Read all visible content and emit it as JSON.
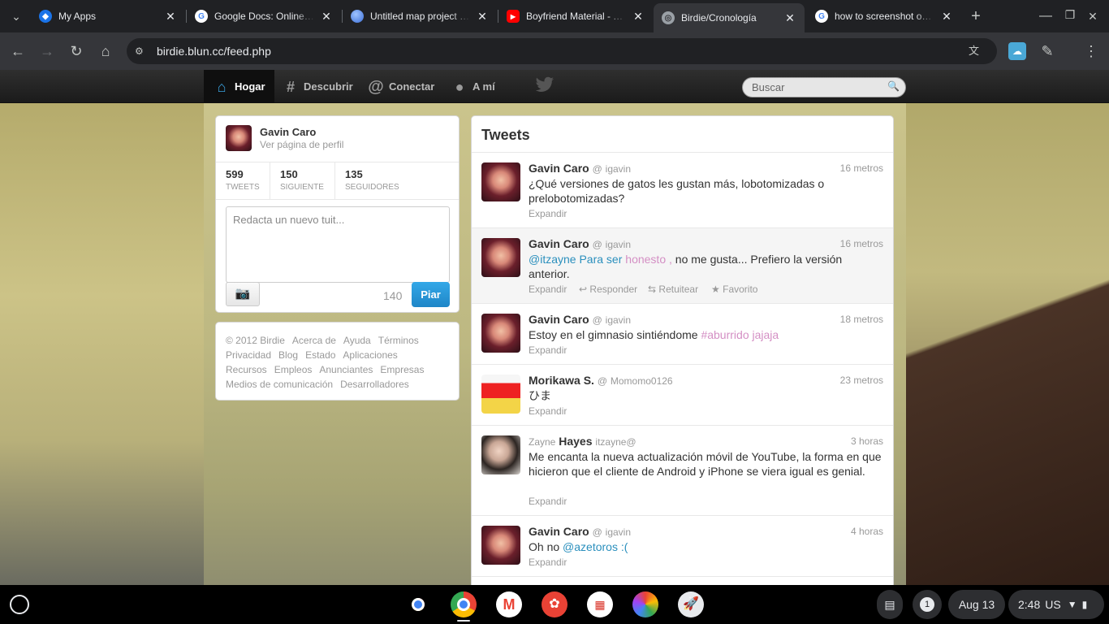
{
  "browser": {
    "tabs": [
      {
        "title": "My Apps",
        "favicon": "cloud-apps-icon",
        "color": "#1a73e8"
      },
      {
        "title": "Google Docs: Online Docu",
        "favicon": "google-g-icon",
        "color": "#4285f4"
      },
      {
        "title": "Untitled map project - Go",
        "favicon": "earth-icon",
        "color": "#4f7fe0"
      },
      {
        "title": "Boyfriend Material - YouTu",
        "favicon": "youtube-icon",
        "color": "#ff0000"
      },
      {
        "title": "Birdie/Cronología",
        "favicon": "globe-icon",
        "color": "#9aa0a6"
      },
      {
        "title": "how to screenshot on chro",
        "favicon": "google-g-icon",
        "color": "#4285f4"
      }
    ],
    "url": "birdie.blun.cc/feed.php"
  },
  "site": {
    "nav": [
      {
        "label": "Hogar",
        "icon": "home-icon"
      },
      {
        "label": "Descubrir",
        "icon": "hashtag-icon"
      },
      {
        "label": "Conectar",
        "icon": "at-icon"
      },
      {
        "label": "A mí",
        "icon": "user-icon"
      }
    ],
    "search_placeholder": "Buscar",
    "profile": {
      "name": "Gavin Caro",
      "link": "Ver página de perfil",
      "stats": [
        {
          "value": "599",
          "label": "TWEETS"
        },
        {
          "value": "150",
          "label": "SIGUIENTE"
        },
        {
          "value": "135",
          "label": "SEGUIDORES"
        }
      ],
      "compose_placeholder": "Redacta un nuevo tuit...",
      "char_count": "140",
      "post_button": "Piar"
    },
    "footer_links": [
      "© 2012 Birdie",
      "Acerca de",
      "Ayuda",
      "Términos",
      "Privacidad",
      "Blog",
      "Estado",
      "Aplicaciones",
      "Recursos",
      "Empleos",
      "Anunciantes",
      "Empresas",
      "Medios de comunicación",
      "Desarrolladores"
    ],
    "timeline": {
      "title": "Tweets",
      "expand": "Expandir",
      "actions": {
        "reply": "Responder",
        "retweet": "Retuitear",
        "favorite": "Favorito"
      },
      "tweets": [
        {
          "name": "Gavin Caro",
          "at": "@",
          "handle": "igavin",
          "time": "16 metros",
          "text": "¿Qué versiones de gatos les gustan más, lobotomizadas o prelobotomizadas?"
        },
        {
          "name": "Gavin Caro",
          "at": "@",
          "handle": "igavin",
          "time": "16 metros",
          "mention": "@itzayne",
          "t1": " Para ser ",
          "pink": "honesto ,",
          "text": " no me gusta... Prefiero la versión anterior."
        },
        {
          "name": "Gavin Caro",
          "at": "@",
          "handle": "igavin",
          "time": "18 metros",
          "text": "Estoy en el gimnasio sintiéndome ",
          "pink": "#aburrido jajaja"
        },
        {
          "name": "Morikawa S.",
          "at": "@",
          "handle": "Momomo0126",
          "time": "23 metros",
          "text": "ひま"
        },
        {
          "first": "Zayne",
          "name": "Hayes",
          "handle": "itzayne@",
          "time": "3 horas",
          "text": "Me encanta la nueva actualización móvil de YouTube, la forma en que hicieron que el cliente de Android y iPhone se viera igual es genial."
        },
        {
          "name": "Gavin Caro",
          "at": "@",
          "handle": "igavin",
          "time": "4 horas",
          "text": "Oh no ",
          "mention": "@azetoros :("
        }
      ]
    }
  },
  "system": {
    "date": "Aug 13",
    "time": "2:48",
    "locale": "US",
    "notifications": "1"
  }
}
